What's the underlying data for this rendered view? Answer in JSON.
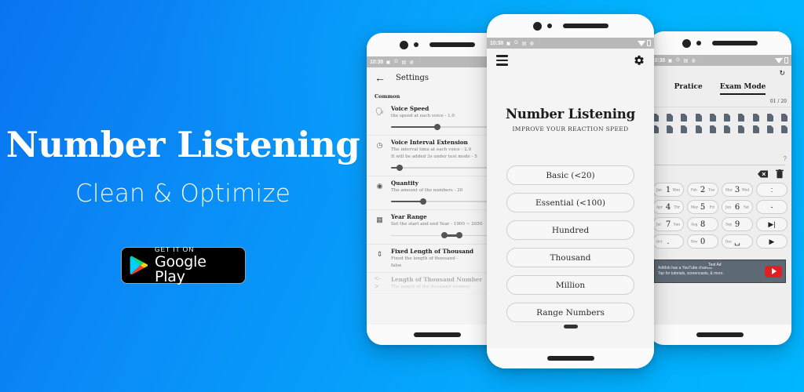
{
  "background": {
    "gradient_from": "#0a74f0",
    "gradient_to": "#00b6ff"
  },
  "promo": {
    "title": "Number Listening",
    "subtitle": "Clean & Optimize",
    "store_badge": {
      "small_label": "GET IT ON",
      "big_label": "Google Play"
    }
  },
  "phone_center": {
    "statusbar": {
      "time": "10:38"
    },
    "appbar": {
      "menu_icon": "hamburger-menu-icon",
      "settings_icon": "gear-icon"
    },
    "title": "Number Listening",
    "subtitle": "IMPROVE YOUR REACTION SPEED",
    "buttons": [
      {
        "label": "Basic (<20)"
      },
      {
        "label": "Essential (<100)"
      },
      {
        "label": "Hundred"
      },
      {
        "label": "Thousand"
      },
      {
        "label": "Million"
      },
      {
        "label": "Range Numbers"
      }
    ]
  },
  "phone_left": {
    "statusbar": {
      "time": "10:38"
    },
    "appbar": {
      "back_icon": "arrow-back-icon",
      "title": "Settings"
    },
    "section_header": "Common",
    "rows": [
      {
        "icon": "voice-speed-icon",
        "title": "Voice Speed",
        "desc": "the speed at each voice  -  1.0",
        "slider": {
          "percent": 42
        }
      },
      {
        "icon": "clock-icon",
        "title": "Voice Interval Extension",
        "desc": "The interval time at each voice  -  2.0",
        "desc2": "It will be added 3s under test mode  -  5",
        "slider": {
          "percent": 8
        }
      },
      {
        "icon": "quantity-icon",
        "title": "Quantity",
        "desc": "The amount of the numbers  -  20",
        "slider": {
          "percent": 29
        }
      },
      {
        "icon": "calendar-icon",
        "title": "Year Range",
        "desc": "Set the start and end Year  -  1900 ~ 2050",
        "range": {
          "start_percent": 48,
          "end_percent": 62
        }
      },
      {
        "icon": "fixed-length-icon",
        "title": "Fixed Length of Thousand",
        "desc": "Fixed the length of thousand  -",
        "desc2": "false"
      },
      {
        "icon": "length-icon",
        "title": "Length of Thousand Number",
        "desc": "The length of the thousand number  -",
        "faded": true
      }
    ]
  },
  "phone_right": {
    "statusbar": {
      "time": "10:38"
    },
    "refresh_icon": "refresh-icon",
    "tabs": [
      {
        "label": "Pratice",
        "active": false
      },
      {
        "label": "Exam Mode",
        "active": true
      }
    ],
    "counter": "01 / 20",
    "grid_icon_count_per_row": 10,
    "grid_rows": 2,
    "help_icon": "help-circle-icon",
    "actions": [
      {
        "icon": "backspace-icon"
      },
      {
        "icon": "trash-icon"
      }
    ],
    "keypad": [
      [
        {
          "left": "Jan",
          "main": "1",
          "right": "Mon"
        },
        {
          "left": "Feb",
          "main": "2",
          "right": "Tue"
        },
        {
          "left": "Mar",
          "main": "3",
          "right": "Wed"
        },
        {
          "main": ":",
          "symbol": true
        }
      ],
      [
        {
          "left": "Apr",
          "main": "4",
          "right": "Thr"
        },
        {
          "left": "May",
          "main": "5",
          "right": "Fri"
        },
        {
          "left": "Jun",
          "main": "6",
          "right": "Sat"
        },
        {
          "main": "-",
          "symbol": true
        }
      ],
      [
        {
          "left": "Jul",
          "main": "7",
          "right": "Sun"
        },
        {
          "left": "Aug",
          "main": "8",
          "right": ""
        },
        {
          "left": "Sep",
          "main": "9",
          "right": ""
        },
        {
          "main": "▶|",
          "symbol": true
        }
      ],
      [
        {
          "left": "Oct",
          "main": ".",
          "right": ""
        },
        {
          "left": "Nov",
          "main": "0",
          "right": ""
        },
        {
          "left": "Dec",
          "main": "␣",
          "right": ""
        },
        {
          "main": "▶",
          "symbol": true
        }
      ]
    ],
    "ad": {
      "tag": "Test Ad",
      "line1": "AdMob has a YouTube channel",
      "line2": "Tap for tutorials, screencasts, & more.",
      "brand_icon": "youtube-play-icon"
    }
  }
}
